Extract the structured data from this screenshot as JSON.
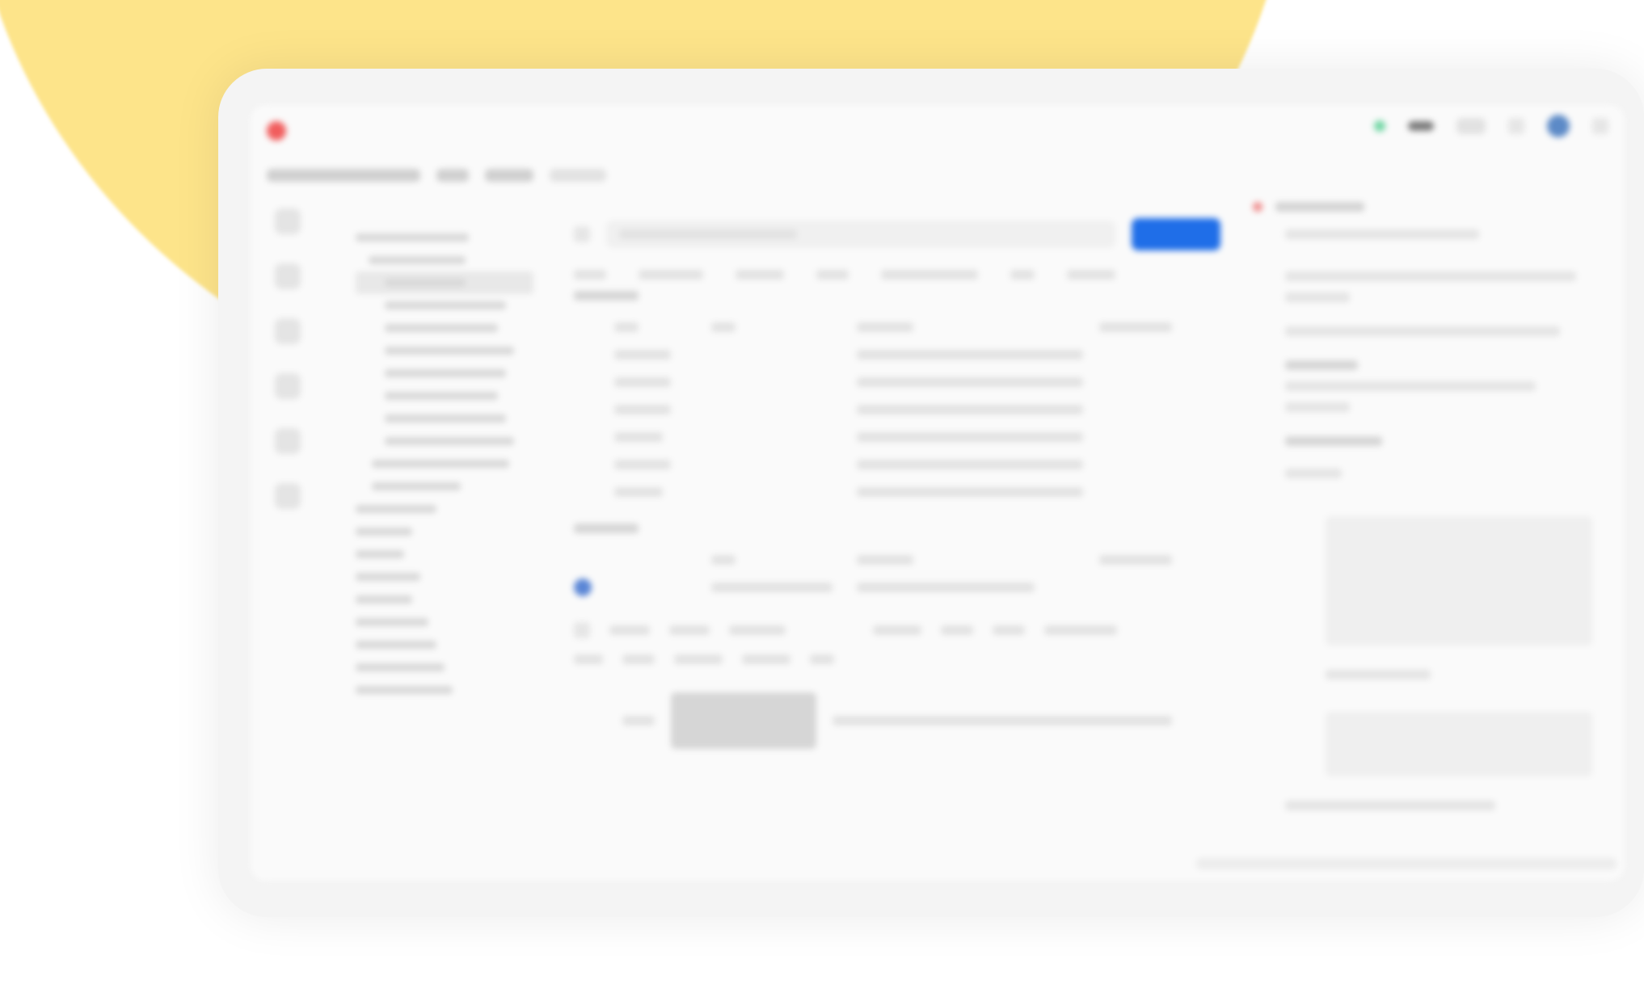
{
  "colors": {
    "background_blob": "#fde48a",
    "accent_blue": "#1f6ee8",
    "close_red": "#f15d5d",
    "status_green": "#6fd6a3"
  },
  "titlebar": {
    "close_icon": "close-dot-icon",
    "nav_links": [
      "",
      "",
      "",
      ""
    ],
    "center_text": "",
    "right_chip": ""
  },
  "subbar": {
    "items": [
      "",
      "",
      ""
    ]
  },
  "rail": {
    "icons": [
      "home-icon",
      "collection-icon",
      "api-icon",
      "environment-icon",
      "history-icon",
      "settings-icon"
    ]
  },
  "tree": {
    "rows": 22
  },
  "main": {
    "top_tabs": [
      "",
      "",
      "",
      ""
    ],
    "url_value": "",
    "send_label": "",
    "request_tabs": [
      "",
      "",
      "",
      "",
      "",
      "",
      ""
    ],
    "params_title": "",
    "headers_title": "",
    "params_rows": 6,
    "response_tabs": [
      "",
      "",
      "",
      ""
    ]
  },
  "right": {
    "title": "",
    "heading_one": "",
    "heading_two": "",
    "label": ""
  }
}
